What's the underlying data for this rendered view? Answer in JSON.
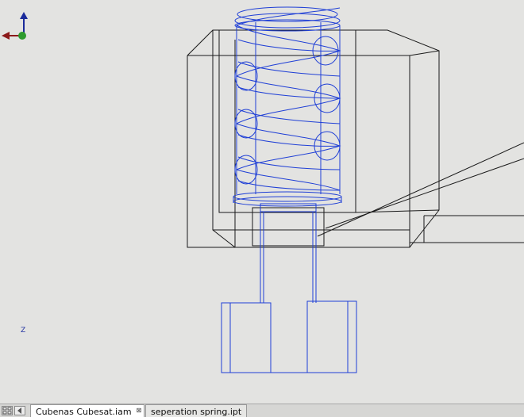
{
  "viewport": {
    "background_color": "#e3e3e1",
    "spring_color": "#1f3fd6",
    "housing_color": "#1a1a1a"
  },
  "triad": {
    "z_label": "Z",
    "z_axis_color": "#1a2a9a",
    "x_axis_color": "#8b1a1a",
    "origin_color": "#2e9b2e"
  },
  "tabs": [
    {
      "label": "Cubenas Cubesat.iam",
      "active": true,
      "close_icon": "close-icon"
    },
    {
      "label": "seperation spring.ipt",
      "active": false
    }
  ],
  "tab_nav": {
    "left_icon": "grid-icon",
    "right_icon": "chevron-left-icon"
  }
}
